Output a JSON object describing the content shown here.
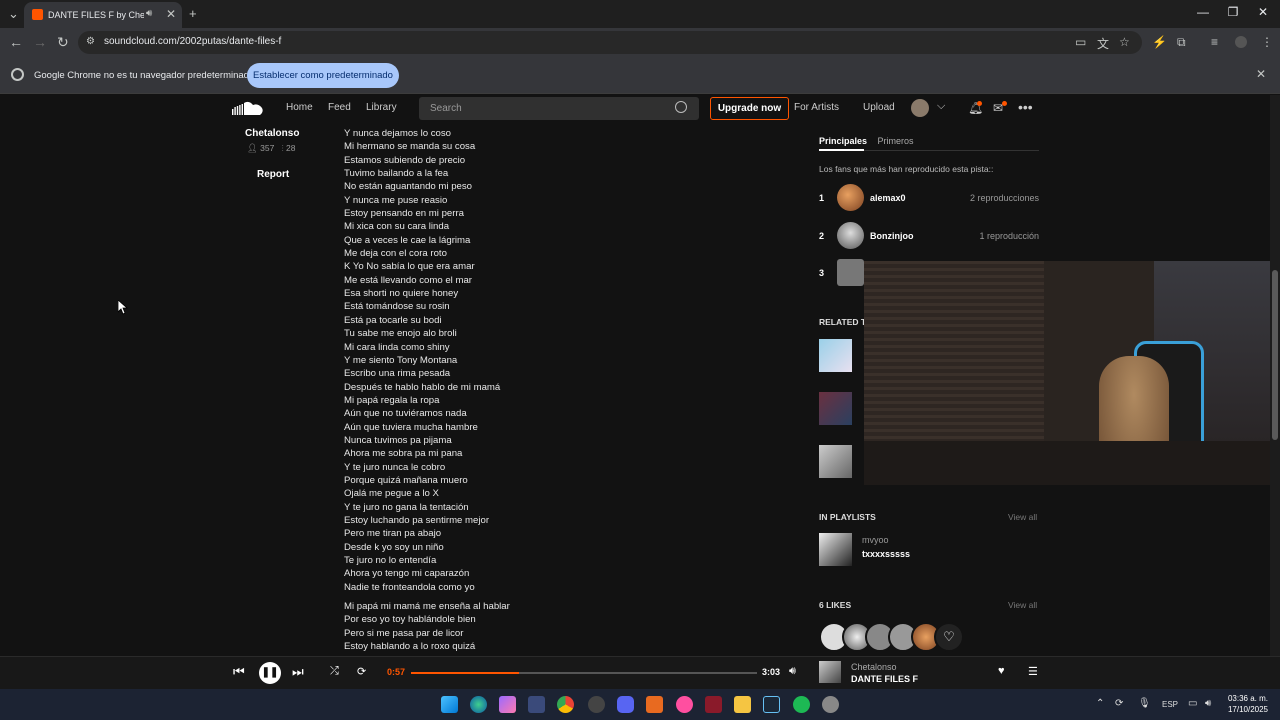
{
  "browser": {
    "tab_title": "DANTE FILES F by Chetalonso",
    "audio_icon": "speaker-icon",
    "url": "soundcloud.com/2002putas/dante-files-f",
    "new_tab_label": "+",
    "window_controls": {
      "minimize": "—",
      "restore": "❐",
      "close": "✕"
    }
  },
  "infobar": {
    "message": "Google Chrome no es tu navegador predeterminado",
    "button_label": "Establecer como predeterminado",
    "close_label": "✕"
  },
  "soundcloud_header": {
    "nav": [
      "Home",
      "Feed",
      "Library"
    ],
    "search_placeholder": "Search",
    "upgrade_label": "Upgrade now",
    "for_artists_label": "For Artists",
    "upload_label": "Upload"
  },
  "artist": {
    "name": "Chetalonso",
    "followers": "357",
    "tracks": "28",
    "report_label": "Report"
  },
  "lyrics_block1": [
    "Y nunca dejamos lo coso",
    "Mi hermano se manda su cosa",
    "Estamos subiendo de precio",
    "Tuvimo bailando a la fea",
    "No están aguantando mi peso",
    "Y nunca me puse reasio",
    "Estoy pensando en mi perra",
    "Mi xica con su cara linda",
    "Que a veces le cae la lágrima",
    "Me deja con el cora roto",
    "K Yo No sabía lo que era amar",
    "Me está llevando como el mar",
    "Esa shorti no quiere honey",
    "Está tomándose su rosin",
    "Está pa tocarle su bodi",
    "Tu sabe me enojo alo broli",
    "Mi cara linda como shiny",
    "Y me siento Tony Montana",
    "Escribo una rima pesada",
    "Después te hablo hablo de mi mamá",
    "Mi papá regala la ropa",
    "Aún que no tuviéramos nada",
    "Aún que tuviera mucha hambre",
    "Nunca tuvimos pa pijama",
    "Ahora me sobra pa mi pana",
    "Y te juro nunca le cobro",
    "Porque quizá mañana muero",
    "Ojalá me pegue a lo X",
    "Y te juro no gana la tentación",
    "Estoy luchando pa sentirme mejor",
    "Pero me tiran pa abajo",
    "Desde k yo soy un niño",
    "Te juro no lo entendía",
    "Ahora yo tengo mi caparazón",
    "Nadie te fronteandola como yo"
  ],
  "lyrics_block2": [
    "Mi papá mi mamá me enseña al hablar",
    "Por eso yo toy hablándole bien",
    "Pero si me pasa par de licor",
    "Estoy hablando a lo roxo quizá"
  ],
  "fans": {
    "tabs": [
      "Principales",
      "Primeros"
    ],
    "title": "Los fans que más han reproducido esta pista::",
    "rows": [
      {
        "rank": "1",
        "name": "alemax0",
        "plays": "2 reproducciones"
      },
      {
        "rank": "2",
        "name": "Bonzinjoo",
        "plays": "1 reproducción"
      },
      {
        "rank": "3",
        "name": "",
        "plays": ""
      }
    ]
  },
  "related": {
    "title": "RELATED TI"
  },
  "playlists": {
    "title": "IN PLAYLISTS",
    "view_all": "View all",
    "item_user": "mvyoo",
    "item_name": "txxxxsssss"
  },
  "likes": {
    "title": "6 LIKES",
    "view_all": "View all"
  },
  "player": {
    "elapsed": "0:57",
    "duration": "3:03",
    "progress": 0.311,
    "artist": "Chetalonso",
    "track": "DANTE FILES F"
  },
  "taskbar": {
    "language": "ESP",
    "time": "03:36 a. m.",
    "date": "17/10/2025"
  },
  "colors": {
    "accent": "#ff5500",
    "infobar_button": "#a8c7fa",
    "taskbar": "#1c2333"
  }
}
